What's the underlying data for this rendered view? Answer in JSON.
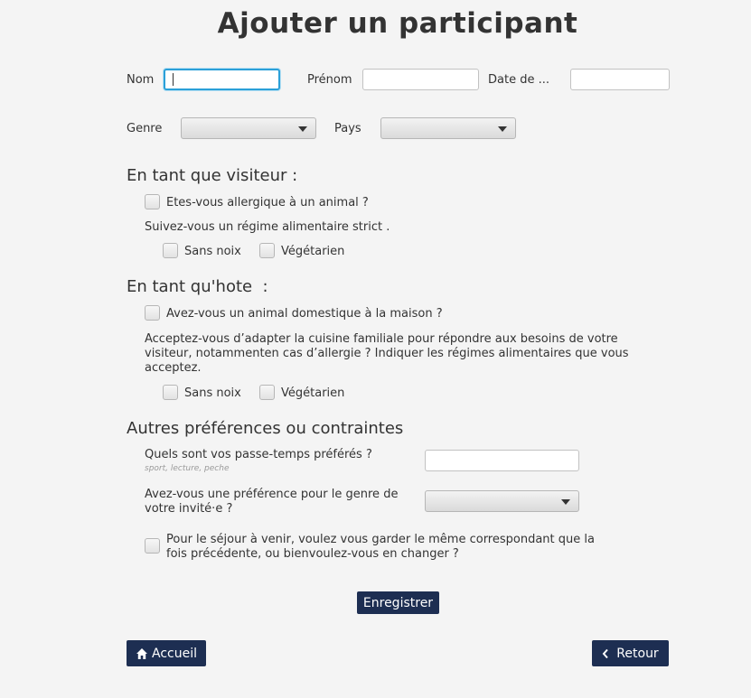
{
  "page": {
    "title": "Ajouter un participant"
  },
  "identity": {
    "nom_label": "Nom",
    "nom_value": "",
    "prenom_label": "Prénom",
    "prenom_value": "",
    "date_label": "Date de ...",
    "date_value": "",
    "genre_label": "Genre",
    "genre_value": "",
    "pays_label": "Pays",
    "pays_value": ""
  },
  "visitor": {
    "heading": "En tant que visiteur :",
    "allergy_label": "Etes-vous allergique à un animal ?",
    "allergy_checked": false,
    "diet_question": "Suivez-vous un régime alimentaire strict .",
    "options": [
      {
        "label": "Sans noix",
        "checked": false
      },
      {
        "label": "Végétarien",
        "checked": false
      }
    ]
  },
  "host": {
    "heading": "En tant qu'hote  :",
    "pet_label": "Avez-vous un animal domestique à la maison ?",
    "pet_checked": false,
    "adapt_question": "Acceptez-vous d’adapter la cuisine familiale pour répondre aux besoins de votre visiteur, notammenten cas d’allergie ? Indiquer les régimes alimentaires que vous acceptez.",
    "options": [
      {
        "label": "Sans noix",
        "checked": false
      },
      {
        "label": "Végétarien",
        "checked": false
      }
    ]
  },
  "preferences": {
    "heading": "Autres préférences ou contraintes",
    "hobbies_label": "Quels sont vos passe-temps préférés ?",
    "hobbies_hint": "sport, lecture, peche",
    "hobbies_value": "",
    "gender_pref_label": "Avez-vous une préférence pour le genre de votre invité·e ?",
    "gender_pref_value": "",
    "same_host_label": "Pour le séjour à venir, voulez vous garder le même correspondant que la fois précédente, ou bienvoulez-vous en changer ?",
    "same_host_checked": false
  },
  "actions": {
    "save_label": "Enregistrer",
    "home_label": "Accueil",
    "back_label": "Retour"
  },
  "colors": {
    "button_bg": "#1d2e52",
    "focus_border": "#2ba0d8",
    "background": "#f4f4f4"
  },
  "icons": {
    "home": "home-icon",
    "back": "chevron-left-icon"
  }
}
